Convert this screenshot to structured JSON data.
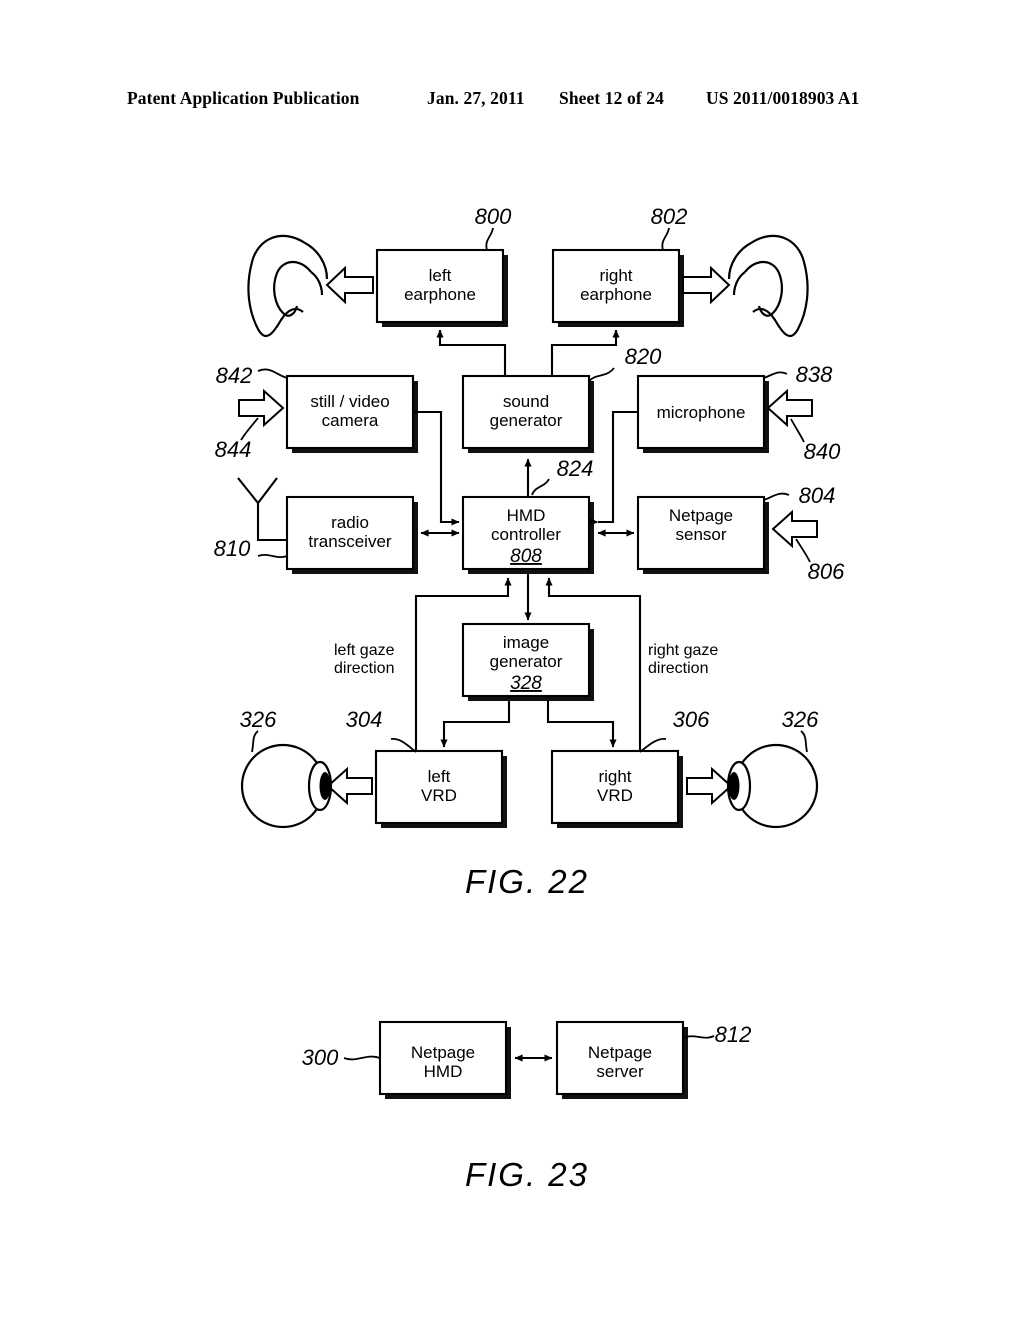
{
  "header": {
    "publication": "Patent Application Publication",
    "date": "Jan. 27, 2011",
    "sheet": "Sheet 12 of 24",
    "docnum": "US 2011/0018903 A1"
  },
  "fig22": {
    "caption": "FIG. 22",
    "blocks": {
      "left_earphone": {
        "line1": "left",
        "line2": "earphone",
        "ref": "800"
      },
      "right_earphone": {
        "line1": "right",
        "line2": "earphone",
        "ref": "802"
      },
      "camera": {
        "line1": "still / video",
        "line2": "camera",
        "ref": "842",
        "input_ref": "844"
      },
      "sound_generator": {
        "line1": "sound",
        "line2": "generator",
        "ref": "820"
      },
      "microphone": {
        "line1": "microphone",
        "ref": "838",
        "input_ref": "840"
      },
      "radio_transceiver": {
        "line1": "radio",
        "line2": "transceiver",
        "ref": "810"
      },
      "hmd_controller": {
        "line1": "HMD",
        "line2": "controller",
        "inner_ref": "808",
        "link_ref": "824"
      },
      "netpage_sensor": {
        "line1": "Netpage",
        "line2": "sensor",
        "ref": "804",
        "input_ref": "806"
      },
      "image_generator": {
        "line1": "image",
        "line2": "generator",
        "inner_ref": "328"
      },
      "left_vrd": {
        "line1": "left",
        "line2": "VRD",
        "ref": "304"
      },
      "right_vrd": {
        "line1": "right",
        "line2": "VRD",
        "ref": "306"
      }
    },
    "labels": {
      "left_gaze_1": "left gaze",
      "left_gaze_2": "direction",
      "right_gaze_1": "right gaze",
      "right_gaze_2": "direction",
      "left_eye_ref": "326",
      "right_eye_ref": "326"
    }
  },
  "fig23": {
    "caption": "FIG. 23",
    "blocks": {
      "netpage_hmd": {
        "line1": "Netpage",
        "line2": "HMD",
        "ref": "300"
      },
      "netpage_server": {
        "line1": "Netpage",
        "line2": "server",
        "ref": "812"
      }
    }
  },
  "colors": {
    "ink": "#000000",
    "paper": "#ffffff",
    "shadow": "#111111"
  }
}
